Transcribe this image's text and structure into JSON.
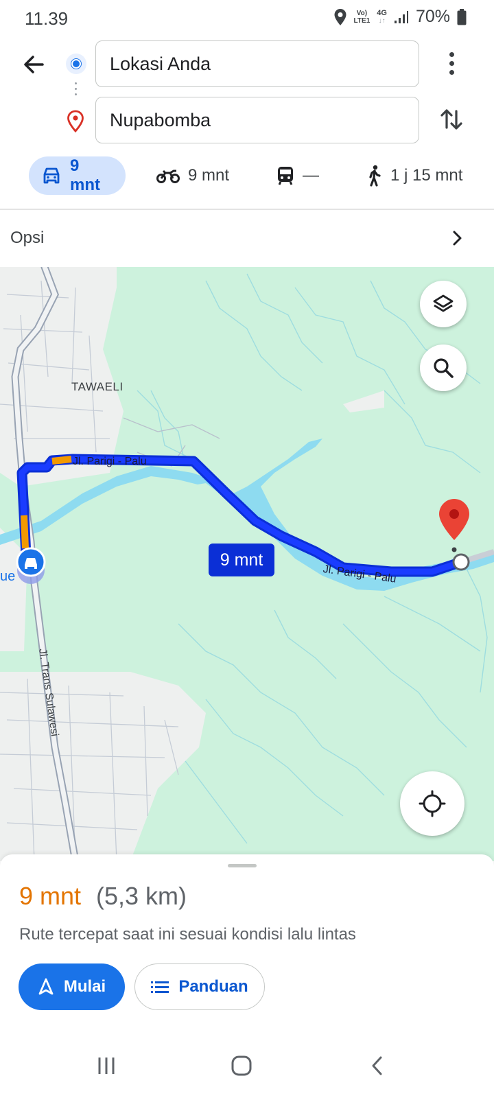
{
  "status_bar": {
    "time": "11.39",
    "network_label_top": "Vo)",
    "network_label_bottom": "LTE1",
    "network_type": "4G",
    "battery": "70%"
  },
  "search": {
    "origin": "Lokasi Anda",
    "destination": "Nupabomba"
  },
  "modes": [
    {
      "name": "car",
      "label": "9 mnt",
      "active": true
    },
    {
      "name": "motorcycle",
      "label": "9 mnt",
      "active": false
    },
    {
      "name": "transit",
      "label": "—",
      "active": false
    },
    {
      "name": "walk",
      "label": "1 j 15 mnt",
      "active": false
    }
  ],
  "options": {
    "label": "Opsi"
  },
  "map": {
    "place_label": "TAWAELI",
    "road_label_1": "Jl. Parigi - Palu",
    "road_label_2": "Jl. Parigi - Palu",
    "road_label_3": "Jl. Trans Sulawesi",
    "edge_label": "ue",
    "route_bubble": "9 mnt"
  },
  "sheet": {
    "duration": "9 mnt",
    "distance": "(5,3 km)",
    "description": "Rute tercepat saat ini sesuai kondisi lalu lintas",
    "start_label": "Mulai",
    "guide_label": "Panduan"
  },
  "colors": {
    "accent": "#1a73e8",
    "route": "#0b2fd6",
    "traffic": "#f29900",
    "duration": "#e37400",
    "map_green": "#cdf2dd",
    "water": "#8edbf0"
  }
}
